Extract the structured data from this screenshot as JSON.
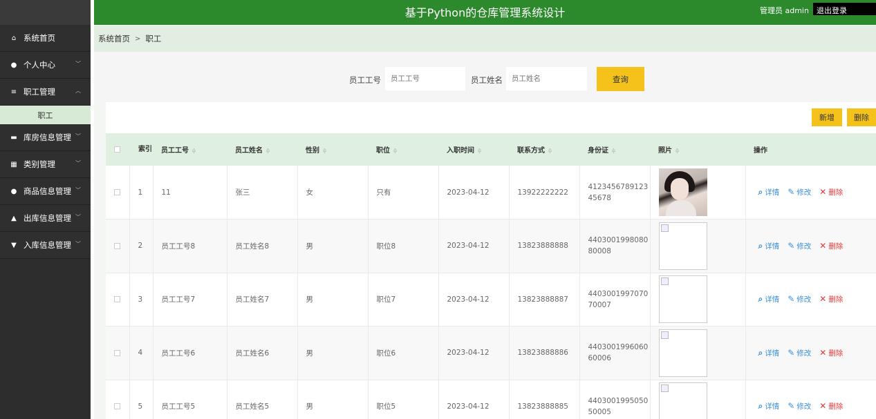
{
  "header": {
    "title": "基于Python的仓库管理系统设计",
    "user": "管理员 admin",
    "logout": "退出登录"
  },
  "sidebar": {
    "items": [
      {
        "label": "系统首页",
        "icon": "home-icon",
        "glyph": "⌂",
        "chevron": false
      },
      {
        "label": "个人中心",
        "icon": "user-icon",
        "glyph": "●",
        "chevron": true
      },
      {
        "label": "职工管理",
        "icon": "list-icon",
        "glyph": "≡",
        "chevron": true,
        "expanded": true
      },
      {
        "label": "库房信息管理",
        "icon": "warehouse-icon",
        "glyph": "▬",
        "chevron": true
      },
      {
        "label": "类别管理",
        "icon": "grid-icon",
        "glyph": "▦",
        "chevron": true
      },
      {
        "label": "商品信息管理",
        "icon": "user-icon",
        "glyph": "●",
        "chevron": true
      },
      {
        "label": "出库信息管理",
        "icon": "thumb-icon",
        "glyph": "▲",
        "chevron": true
      },
      {
        "label": "入库信息管理",
        "icon": "pin-icon",
        "glyph": "▼",
        "chevron": true
      }
    ],
    "submenu": {
      "label": "职工"
    }
  },
  "breadcrumb": {
    "home": "系统首页",
    "separator": ">",
    "current": "职工"
  },
  "search": {
    "emp_no_label": "员工工号",
    "emp_no_placeholder": "员工工号",
    "emp_name_label": "员工姓名",
    "emp_name_placeholder": "员工姓名",
    "query_button": "查询"
  },
  "toolbar": {
    "add_button": "新增",
    "delete_button": "删除"
  },
  "table": {
    "headers": {
      "index": "索引",
      "emp_no": "员工工号",
      "emp_name": "员工姓名",
      "gender": "性别",
      "position": "职位",
      "hire_date": "入职时间",
      "contact": "联系方式",
      "id_card": "身份证",
      "photo": "照片",
      "actions": "操作"
    },
    "sort_glyph": "≑",
    "rows": [
      {
        "index": "1",
        "emp_no": "11",
        "emp_name": "张三",
        "gender": "女",
        "position": "只有",
        "hire_date": "2023-04-12",
        "contact": "13922222222",
        "id_card_1": "4123456789123",
        "id_card_2": "45678",
        "has_photo": true
      },
      {
        "index": "2",
        "emp_no": "员工工号8",
        "emp_name": "员工姓名8",
        "gender": "男",
        "position": "职位8",
        "hire_date": "2023-04-12",
        "contact": "13823888888",
        "id_card_1": "4403001998080",
        "id_card_2": "80008",
        "has_photo": false
      },
      {
        "index": "3",
        "emp_no": "员工工号7",
        "emp_name": "员工姓名7",
        "gender": "男",
        "position": "职位7",
        "hire_date": "2023-04-12",
        "contact": "13823888887",
        "id_card_1": "4403001997070",
        "id_card_2": "70007",
        "has_photo": false
      },
      {
        "index": "4",
        "emp_no": "员工工号6",
        "emp_name": "员工姓名6",
        "gender": "男",
        "position": "职位6",
        "hire_date": "2023-04-12",
        "contact": "13823888886",
        "id_card_1": "4403001996060",
        "id_card_2": "60006",
        "has_photo": false
      },
      {
        "index": "5",
        "emp_no": "员工工号5",
        "emp_name": "员工姓名5",
        "gender": "男",
        "position": "职位5",
        "hire_date": "2023-04-12",
        "contact": "13823888885",
        "id_card_1": "4403001995050",
        "id_card_2": "50005",
        "has_photo": false
      }
    ],
    "actions": {
      "view": "详情",
      "edit": "修改",
      "delete": "删除"
    }
  },
  "colors": {
    "header_green": "#2c8a2c",
    "sidebar_dark": "#2d2d2d",
    "accent_yellow": "#f5c21b",
    "link_blue": "#3a8fd6",
    "danger_red": "#e03a3a"
  }
}
